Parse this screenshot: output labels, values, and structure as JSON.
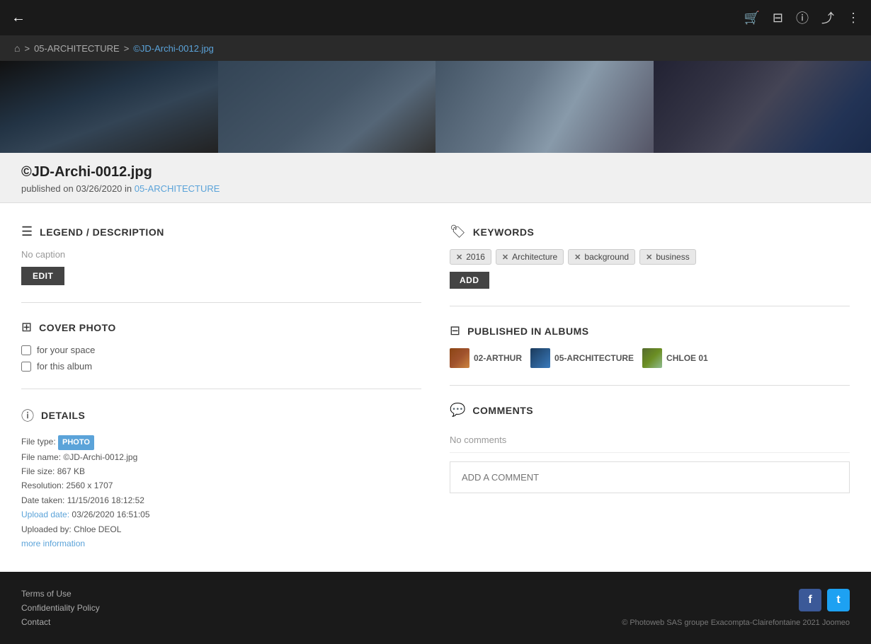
{
  "nav": {
    "back_arrow": "←",
    "icons": [
      "🛒",
      "⬛",
      "ℹ",
      "⤴",
      "⋮"
    ]
  },
  "breadcrumb": {
    "home_icon": "⌂",
    "sep1": ">",
    "folder": "05-ARCHITECTURE",
    "sep2": ">",
    "file": "©JD-Archi-0012.jpg"
  },
  "title": {
    "filename": "©JD-Archi-0012.jpg",
    "published": "published on 03/26/2020 in",
    "album_link": "05-ARCHITECTURE"
  },
  "legend": {
    "section_title": "LEGEND / DESCRIPTION",
    "no_caption": "No caption",
    "edit_label": "EDIT"
  },
  "cover_photo": {
    "section_title": "COVER PHOTO",
    "option1": "for your space",
    "option2": "for this album"
  },
  "details": {
    "section_title": "DETAILS",
    "file_type_label": "File type:",
    "file_type_badge": "PHOTO",
    "file_name_label": "File name:",
    "file_name": "©JD-Archi-0012.jpg",
    "file_size_label": "File size:",
    "file_size": "867 KB",
    "resolution_label": "Resolution:",
    "resolution": "2560 x 1707",
    "date_taken_label": "Date taken:",
    "date_taken": "11/15/2016 18:12:52",
    "upload_date_label": "Upload date:",
    "upload_date": "03/26/2020 16:51:05",
    "uploaded_by_label": "Uploaded by:",
    "uploaded_by": "Chloe DEOL",
    "more_info": "more information"
  },
  "keywords": {
    "section_title": "KEYWORDS",
    "tags": [
      "2016",
      "Architecture",
      "background",
      "business"
    ],
    "add_label": "ADD"
  },
  "albums": {
    "section_title": "PUBLISHED IN ALBUMS",
    "items": [
      {
        "name": "02-ARTHUR"
      },
      {
        "name": "05-ARCHITECTURE"
      },
      {
        "name": "CHLOE 01"
      }
    ]
  },
  "comments": {
    "section_title": "COMMENTS",
    "no_comments": "No comments",
    "add_placeholder": "ADD A COMMENT"
  },
  "footer": {
    "links": [
      "Terms of Use",
      "Confidentiality Policy",
      "Contact"
    ],
    "copyright": "© Photoweb SAS groupe Exacompta-Clairefontaine 2021 Joomeo",
    "facebook": "f",
    "twitter": "t"
  }
}
